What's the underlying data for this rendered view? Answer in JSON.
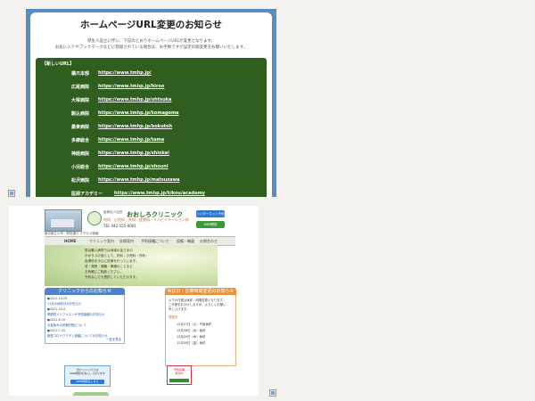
{
  "notice": {
    "title": "ホームページURL変更のお知らせ",
    "body_lines": [
      "厚生人設立に伴い、下記のとおりホームページURLが変更となります。",
      "お気に入りやブックマークなどに登録されている場合は、お手数ですが設定の御変更をお願いいたします。"
    ],
    "url_box_title": "【新しいURL】",
    "urls": [
      {
        "name": "橋爪本部",
        "url": "https://www.tmhp.jp/"
      },
      {
        "name": "広尾病院",
        "url": "https://www.tmhp.jp/hiroo"
      },
      {
        "name": "大塚病院",
        "url": "https://www.tmhp.jp/ohtsuka"
      },
      {
        "name": "駒込病院",
        "url": "https://www.tmhp.jp/komagome"
      },
      {
        "name": "墨東病院",
        "url": "https://www.tmhp.jp/bokutoh"
      },
      {
        "name": "多摩総合",
        "url": "https://www.tmhp.jp/tama"
      },
      {
        "name": "神経病院",
        "url": "https://www.tmhp.jp/shinkei"
      },
      {
        "name": "小児総合",
        "url": "https://www.tmhp.jp/shouni"
      },
      {
        "name": "松沢病院",
        "url": "https://www.tmhp.jp/matsuzawa"
      },
      {
        "name": "医師アカデミー",
        "url": "https://www.tmhp.jp/kikou/academy"
      }
    ]
  },
  "clinic": {
    "name": "おおしろクリニック",
    "subtitle": "医療法人社団",
    "departments": "内科・小児科・外科・皮膚科・リハビリテーション科",
    "tel": "TEL 042-555-0001",
    "address": "東京都立川市・駅前通り アクセス情報",
    "header_buttons": [
      {
        "label": "インターネット予約",
        "color": "#2b78d6"
      },
      {
        "label": "WEB問診",
        "color": "#3a9a3a"
      }
    ],
    "nav": [
      "HOME",
      "クリニック案内",
      "診療案内",
      "予防接種について",
      "設備・機器",
      "お問合わせ"
    ],
    "hero_lines": [
      "泉谷義人病院では地域の皆さまの",
      "かかりつけ医として、内科・小児科・外科・",
      "皮膚科を中心に診療を行っています。",
      "咳・発熱・頭痛・胃腸のことなど",
      "お気軽にご相談ください。",
      "予約なしでも受診していただけます。"
    ],
    "news": {
      "title": "クリニックからのお知らせ",
      "header_color": "#4f82c4",
      "items": [
        {
          "date": "●2022.10.25",
          "text": "11月の休診日のお知らせ"
        },
        {
          "date": "●2022.10.4",
          "text": "季節性インフルエンザ予防接種のお知らせ"
        },
        {
          "date": "●2022.8.10",
          "text": "お盆休みの診療日程について"
        },
        {
          "date": "●2022.7.20",
          "text": "新型コロナワクチン接種についてのお知らせ"
        }
      ],
      "more": "一覧を見る"
    },
    "schedule": {
      "title": "休診日・診療時間変更のお知らせ",
      "header_color": "#e8913a",
      "lines": [
        "以下の日程は休診・時間変更となります。",
        "ご不便をおかけしますが、よろしくお願い",
        "申し上げます。"
      ],
      "label": "変更日",
      "rows": [
        "12月27日（火）午後休診",
        "12月28日（水）休診",
        "12月29日（木）休診",
        "12月30日（金）休診"
      ]
    },
    "banner_left": {
      "lines": [
        "当クリニックでは",
        "WEB問診を導入しております"
      ],
      "button": "WEB問診はこちら"
    },
    "banner_right": {
      "lines": [
        "予防接種",
        "受付中"
      ]
    }
  }
}
